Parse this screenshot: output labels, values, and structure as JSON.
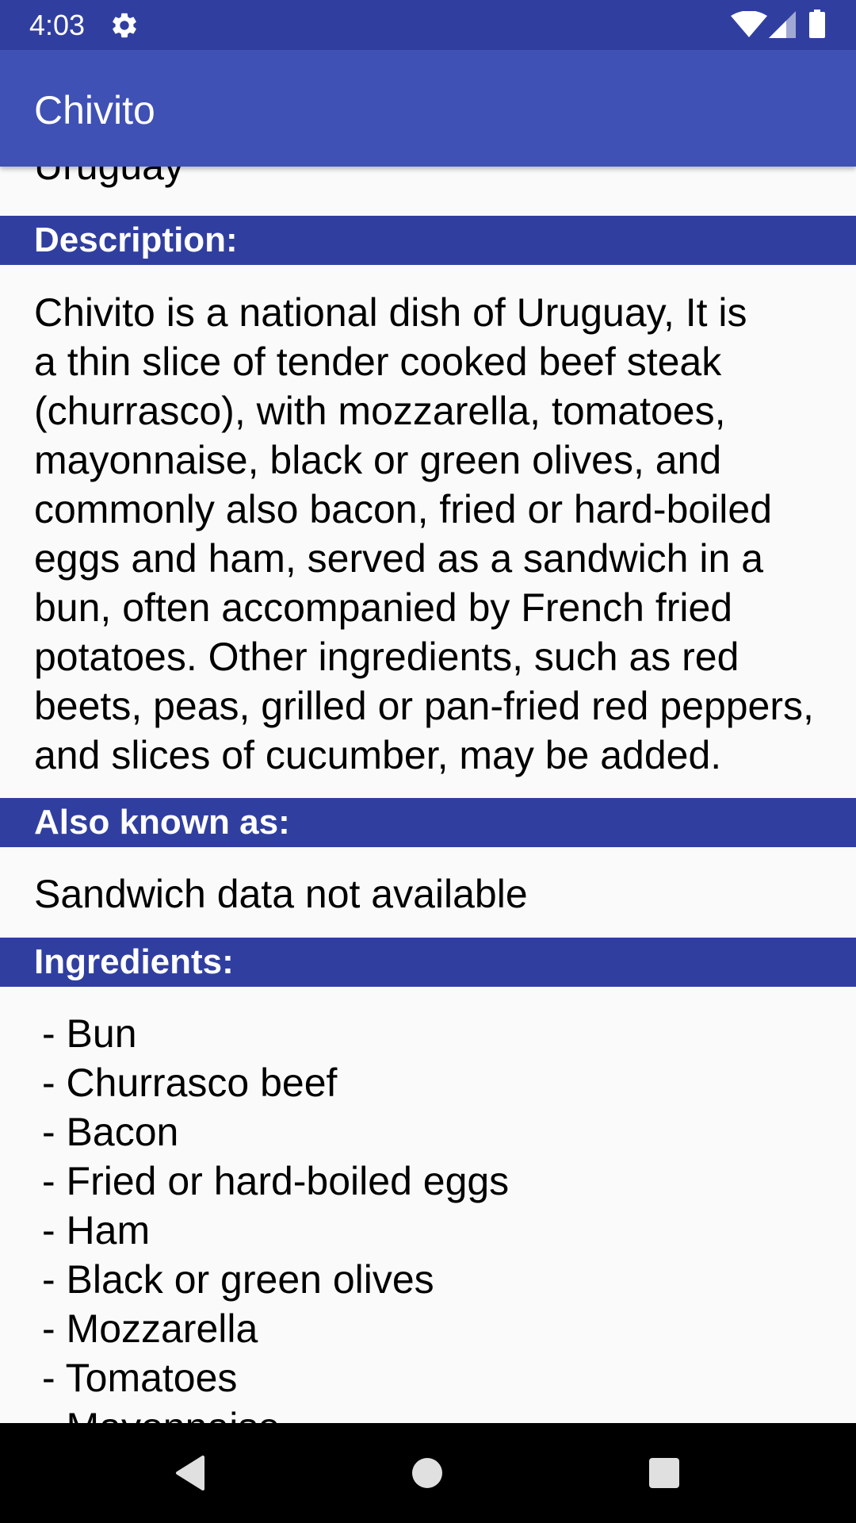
{
  "status_bar": {
    "time": "4:03",
    "icons": [
      "gear-icon",
      "wifi-icon",
      "signal-icon",
      "battery-icon"
    ],
    "color": "#303f9f"
  },
  "app_bar": {
    "title": "Chivito",
    "color": "#3f51b5"
  },
  "origin": {
    "value": "Uruguay"
  },
  "description": {
    "header": "Description:",
    "lines": [
      "Chivito is a national dish of Uruguay, It is",
      "a thin slice of tender cooked beef steak",
      "(churrasco), with mozzarella, tomatoes,",
      "mayonnaise, black or green olives, and",
      "commonly also bacon, fried or hard-boiled",
      "eggs and ham, served as a sandwich in a",
      "bun, often accompanied by French fried",
      "potatoes. Other ingredients, such as red",
      "beets, peas, grilled or pan-fried red peppers,",
      "and slices of cucumber, may be added."
    ]
  },
  "also_known_as": {
    "header": "Also known as:",
    "value": "Sandwich data not available"
  },
  "ingredients": {
    "header": "Ingredients:",
    "items": [
      "- Bun",
      "- Churrasco beef",
      "- Bacon",
      "- Fried or hard-boiled eggs",
      "- Ham",
      "- Black or green olives",
      "- Mozzarella",
      "- Tomatoes",
      "- Mayonnaise"
    ]
  },
  "nav_bar": {
    "buttons": [
      "back-icon",
      "home-icon",
      "recents-icon"
    ]
  },
  "colors": {
    "section_header": "#303f9f",
    "background": "#fafafa",
    "text": "#000000"
  }
}
